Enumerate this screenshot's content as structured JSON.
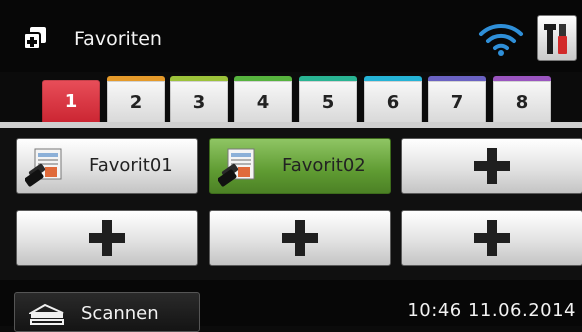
{
  "header": {
    "title": "Favoriten",
    "icons": [
      "favorites-icon",
      "wifi-icon",
      "settings-tools-icon"
    ]
  },
  "tabs": [
    {
      "label": "1",
      "color": "#e03341",
      "active": true
    },
    {
      "label": "2",
      "color": "#e59a2a",
      "active": false
    },
    {
      "label": "3",
      "color": "#9cc23a",
      "active": false
    },
    {
      "label": "4",
      "color": "#57b33e",
      "active": false
    },
    {
      "label": "5",
      "color": "#29b493",
      "active": false
    },
    {
      "label": "6",
      "color": "#25b3d6",
      "active": false
    },
    {
      "label": "7",
      "color": "#6a62c2",
      "active": false
    },
    {
      "label": "8",
      "color": "#9a55c0",
      "active": false
    }
  ],
  "favorites": [
    {
      "label": "Favorit01",
      "type": "favorite",
      "highlighted": false
    },
    {
      "label": "Favorit02",
      "type": "favorite",
      "highlighted": true
    },
    {
      "label": "",
      "type": "add"
    },
    {
      "label": "",
      "type": "add"
    },
    {
      "label": "",
      "type": "add"
    },
    {
      "label": "",
      "type": "add"
    }
  ],
  "footer": {
    "scan_label": "Scannen",
    "datetime": "10:46 11.06.2014"
  },
  "colors": {
    "highlight_green": "#5f9b32",
    "active_tab_red": "#d12a37",
    "wifi_blue": "#2f8fd8"
  }
}
